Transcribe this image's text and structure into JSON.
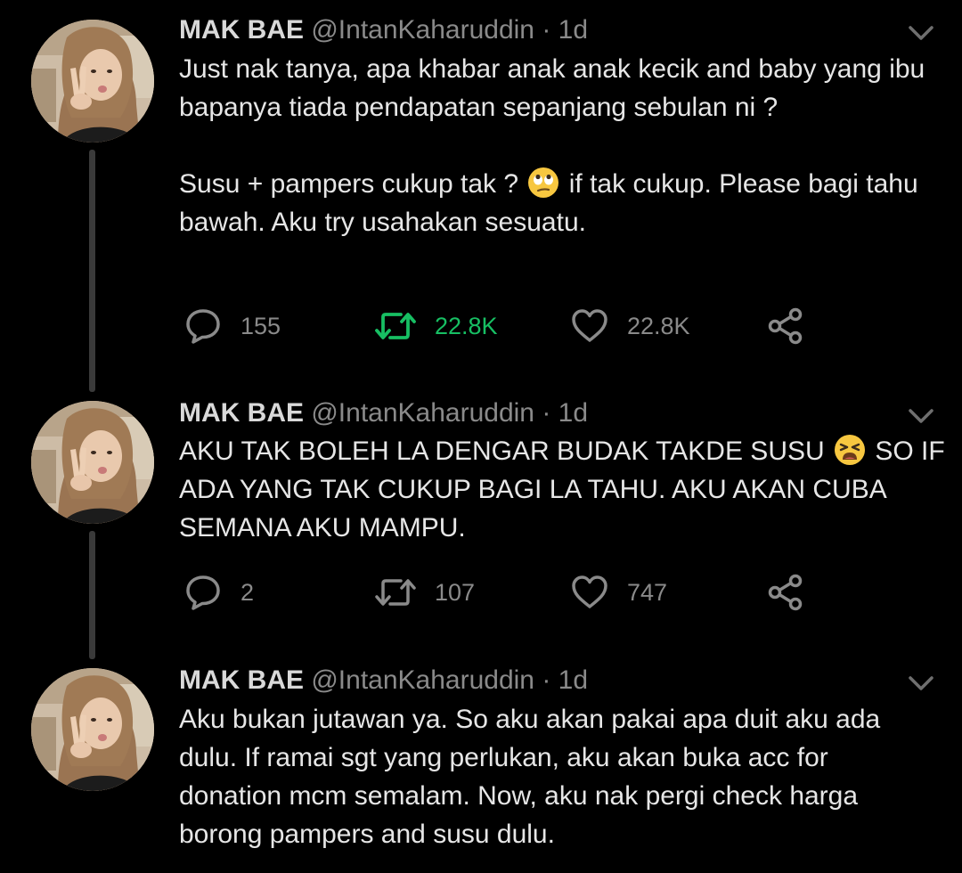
{
  "tweets": [
    {
      "name": "MAK BAE",
      "handle": "@IntanKaharuddin",
      "separator": "·",
      "time": "1d",
      "paragraph1": "Just nak tanya, apa khabar anak anak kecik and baby yang ibu bapanya tiada pendapatan sepanjang sebulan ni ?",
      "p2_before": "Susu + pampers cukup tak ?",
      "p2_emoji": "face-with-rolling-eyes",
      "p2_after": "if tak cukup. Please bagi tahu bawah. Aku try usahakan sesuatu.",
      "replies": "155",
      "retweets": "22.8K",
      "likes": "22.8K",
      "retweeted": true
    },
    {
      "name": "MAK BAE",
      "handle": "@IntanKaharuddin",
      "separator": "·",
      "time": "1d",
      "text_before": "AKU TAK BOLEH LA DENGAR BUDAK TAKDE SUSU",
      "text_emoji": "weary-face",
      "text_after": "SO IF ADA YANG TAK CUKUP BAGI LA TAHU. AKU AKAN CUBA SEMANA AKU MAMPU.",
      "replies": "2",
      "retweets": "107",
      "likes": "747",
      "retweeted": false
    },
    {
      "name": "MAK BAE",
      "handle": "@IntanKaharuddin",
      "separator": "·",
      "time": "1d",
      "text": "Aku bukan jutawan ya. So aku akan pakai apa duit aku ada dulu. If ramai sgt yang perlukan, aku akan buka acc for donation mcm semalam. Now, aku nak pergi check harga borong pampers and susu dulu."
    }
  ],
  "colors": {
    "background": "#000000",
    "text": "#e6e6e6",
    "muted": "#8a8a8a",
    "retweet_active": "#17bf63",
    "thread_line": "#3a3a3a"
  }
}
